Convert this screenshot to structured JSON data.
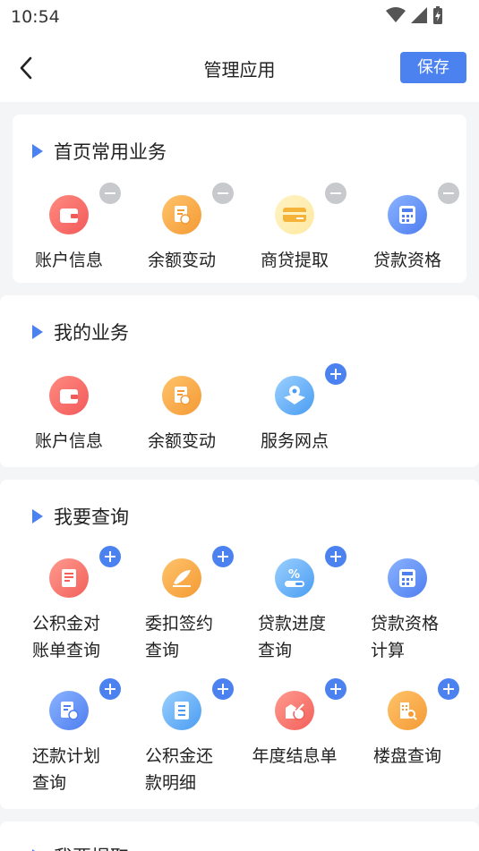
{
  "status": {
    "time": "10:54"
  },
  "header": {
    "title": "管理应用",
    "save_label": "保存"
  },
  "sections": [
    {
      "title": "首页常用业务",
      "items": [
        {
          "label": "账户信息",
          "icon": "wallet-icon",
          "action": "remove"
        },
        {
          "label": "余额变动",
          "icon": "balance-doc-icon",
          "action": "remove"
        },
        {
          "label": "商贷提取",
          "icon": "card-icon",
          "action": "remove"
        },
        {
          "label": "贷款资格",
          "icon": "calculator-icon",
          "action": "remove"
        }
      ]
    },
    {
      "title": "我的业务",
      "items": [
        {
          "label": "账户信息",
          "icon": "wallet-icon",
          "action": "none"
        },
        {
          "label": "余额变动",
          "icon": "balance-doc-icon",
          "action": "none"
        },
        {
          "label": "服务网点",
          "icon": "map-location-icon",
          "action": "add"
        }
      ]
    },
    {
      "title": "我要查询",
      "items": [
        {
          "label": "公积金对\n账单查询",
          "icon": "statement-icon",
          "action": "add"
        },
        {
          "label": "委扣签约\n查询",
          "icon": "sign-pen-icon",
          "action": "add"
        },
        {
          "label": "贷款进度\n查询",
          "icon": "percent-progress-icon",
          "action": "add"
        },
        {
          "label": "贷款资格\n计算",
          "icon": "calculator-icon",
          "action": "none"
        },
        {
          "label": "还款计划\n查询",
          "icon": "repayment-plan-icon",
          "action": "add"
        },
        {
          "label": "公积金还\n款明细",
          "icon": "repayment-detail-icon",
          "action": "add"
        },
        {
          "label": "年度结息单",
          "icon": "annual-interest-icon",
          "action": "add"
        },
        {
          "label": "楼盘查询",
          "icon": "building-search-icon",
          "action": "add"
        }
      ]
    },
    {
      "title": "我要提取"
    }
  ]
}
